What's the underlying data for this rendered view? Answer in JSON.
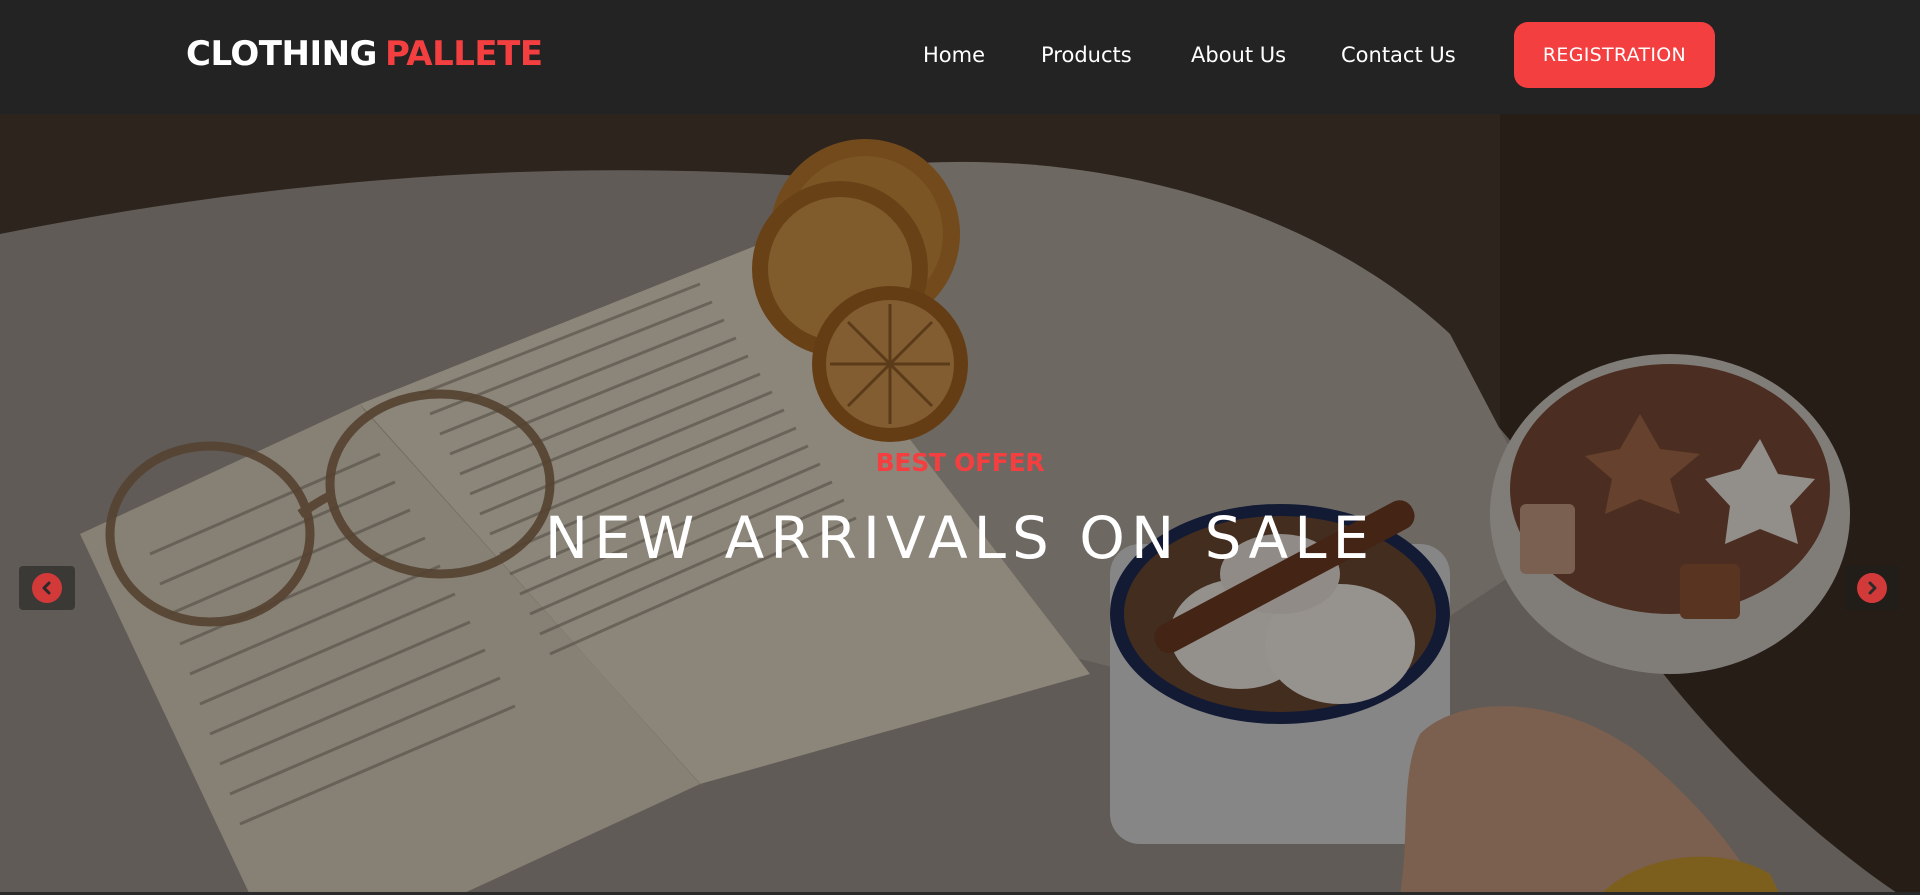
{
  "brand": {
    "part1": "CLOTHING",
    "part2": "PALLETE"
  },
  "nav": {
    "links": [
      "Home",
      "Products",
      "About Us",
      "Contact Us"
    ],
    "cta": "REGISTRATION"
  },
  "hero": {
    "kicker": "BEST OFFER",
    "title": "NEW ARRIVALS ON SALE",
    "prev_icon": "chevron-left-icon",
    "next_icon": "chevron-right-icon"
  },
  "colors": {
    "accent": "#f43f40",
    "navbar": "#232323",
    "text": "#ffffff"
  }
}
